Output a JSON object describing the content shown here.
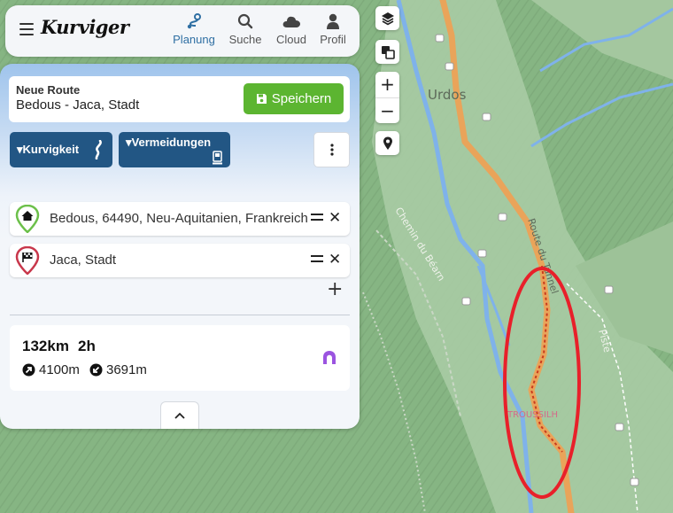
{
  "app": {
    "logo": "Kurviger"
  },
  "nav": {
    "planung": "Planung",
    "suche": "Suche",
    "cloud": "Cloud",
    "profil": "Profil"
  },
  "route": {
    "title": "Neue Route",
    "name": "Bedous - Jaca, Stadt",
    "save_label": "Speichern"
  },
  "options": {
    "curviness_label": "Kurvigkeit",
    "avoid_label": "Vermeidungen"
  },
  "waypoints": [
    {
      "label": "Bedous, 64490, Neu-Aquitanien, Frankreich",
      "type": "start"
    },
    {
      "label": "Jaca, Stadt",
      "type": "destination"
    }
  ],
  "stats": {
    "distance": "132km",
    "duration": "2h",
    "ascent": "4100m",
    "descent": "3691m"
  },
  "map": {
    "labels": {
      "town": "Urdos",
      "road_tunnel": "Route du Tunnel",
      "chemin": "Chemin du Béarn",
      "piste": "Piste",
      "place": "TROUSSILH"
    },
    "zoom_in": "+",
    "zoom_out": "−"
  },
  "colors": {
    "save_green": "#5cb531",
    "option_blue": "#225684",
    "highlight_red": "#e8202a",
    "route_orange": "#e9a45a",
    "water_blue": "#7fb2ea"
  }
}
